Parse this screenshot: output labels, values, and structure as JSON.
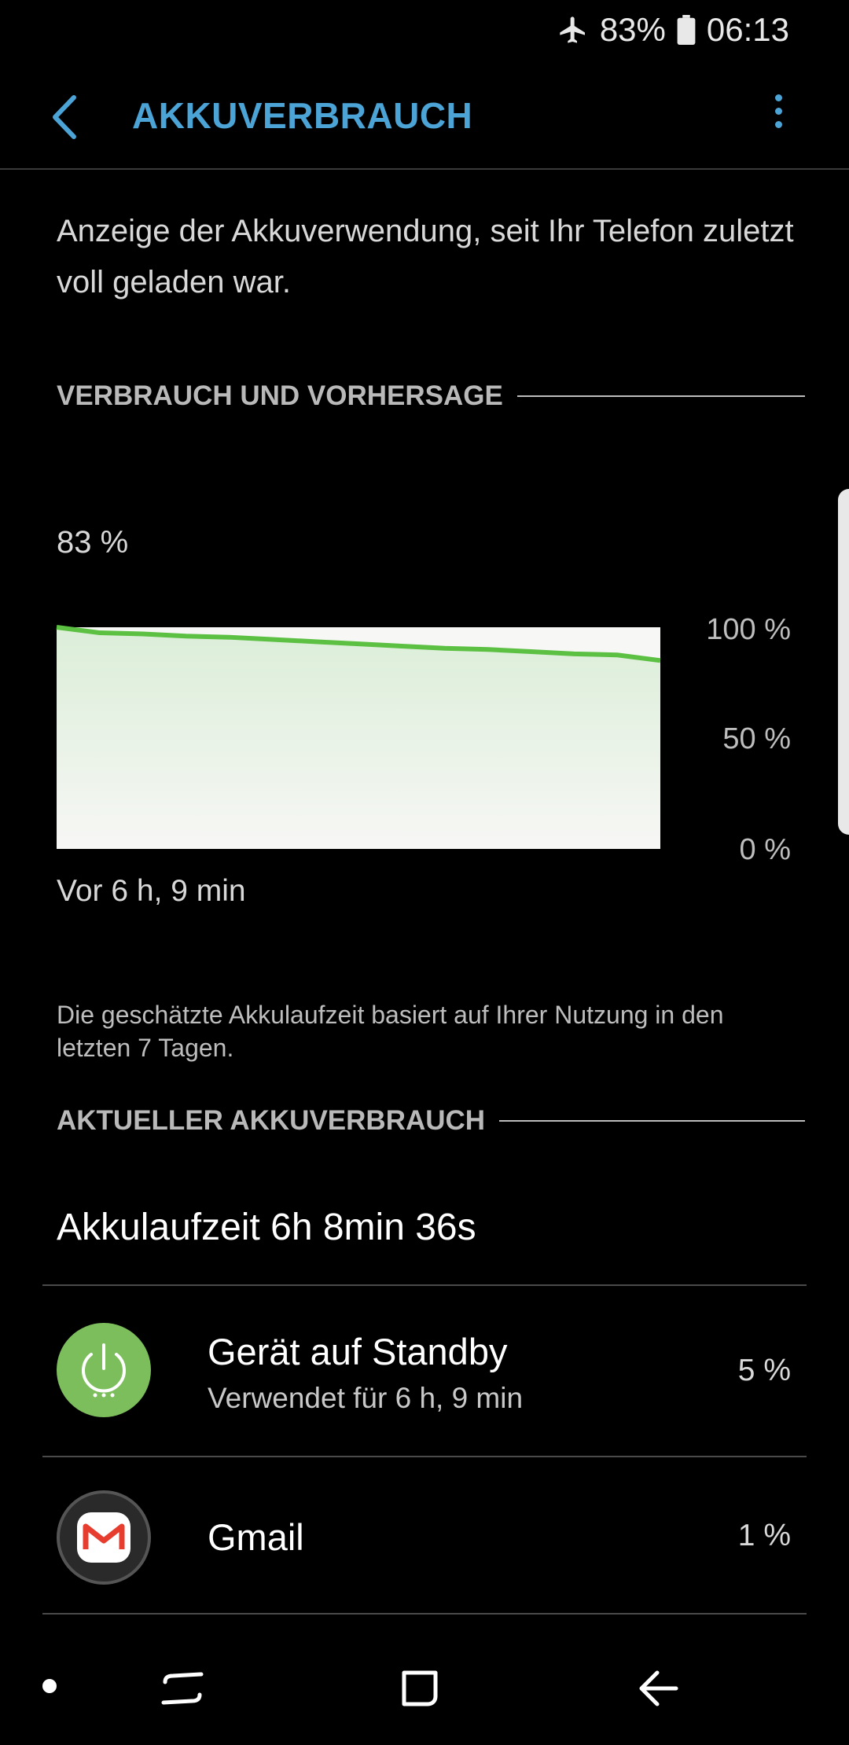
{
  "status": {
    "battery_text": "83%",
    "time": "06:13"
  },
  "appbar": {
    "title": "AKKUVERBRAUCH"
  },
  "intro": "Anzeige der Akkuverwendung, seit Ihr Telefon zuletzt voll geladen war.",
  "section_forecast": {
    "label": "VERBRAUCH UND VORHERSAGE"
  },
  "chart": {
    "current_label": "83 %",
    "foot_label": "Vor 6 h, 9 min",
    "colors": {
      "line": "#5cc043",
      "fill_top": "#dbeed8",
      "fill_bottom": "#f7f7f5",
      "midline": "#cfd6cf"
    }
  },
  "chart_data": {
    "type": "area",
    "x": [
      0,
      1,
      2,
      3,
      4,
      5,
      6,
      7,
      8,
      9,
      10,
      11,
      12,
      13,
      14
    ],
    "y": [
      100,
      97.5,
      97,
      96,
      95.5,
      94.5,
      93.5,
      92.5,
      91.5,
      90.5,
      90,
      89,
      88,
      87.5,
      85
    ],
    "ylim": [
      0,
      100
    ],
    "yticks": [
      "100 %",
      "50 %",
      "0 %"
    ],
    "grid": "midline at 50 %",
    "x_start_label": "Vor 6 h, 9 min"
  },
  "note": "Die geschätzte Akkulaufzeit basiert auf Ihrer Nutzung in den letzten 7 Tagen.",
  "section_current": {
    "label": "AKTUELLER AKKUVERBRAUCH"
  },
  "runtime": "Akkulaufzeit 6h 8min 36s",
  "apps": [
    {
      "icon": "power-icon",
      "name": "Gerät auf Standby",
      "sub": "Verwendet für 6 h, 9 min",
      "percent": "5 %",
      "color": "#7cbd5c"
    },
    {
      "icon": "gmail-icon",
      "name": "Gmail",
      "sub": "",
      "percent": "1 %",
      "color": "#e63d2e"
    }
  ]
}
